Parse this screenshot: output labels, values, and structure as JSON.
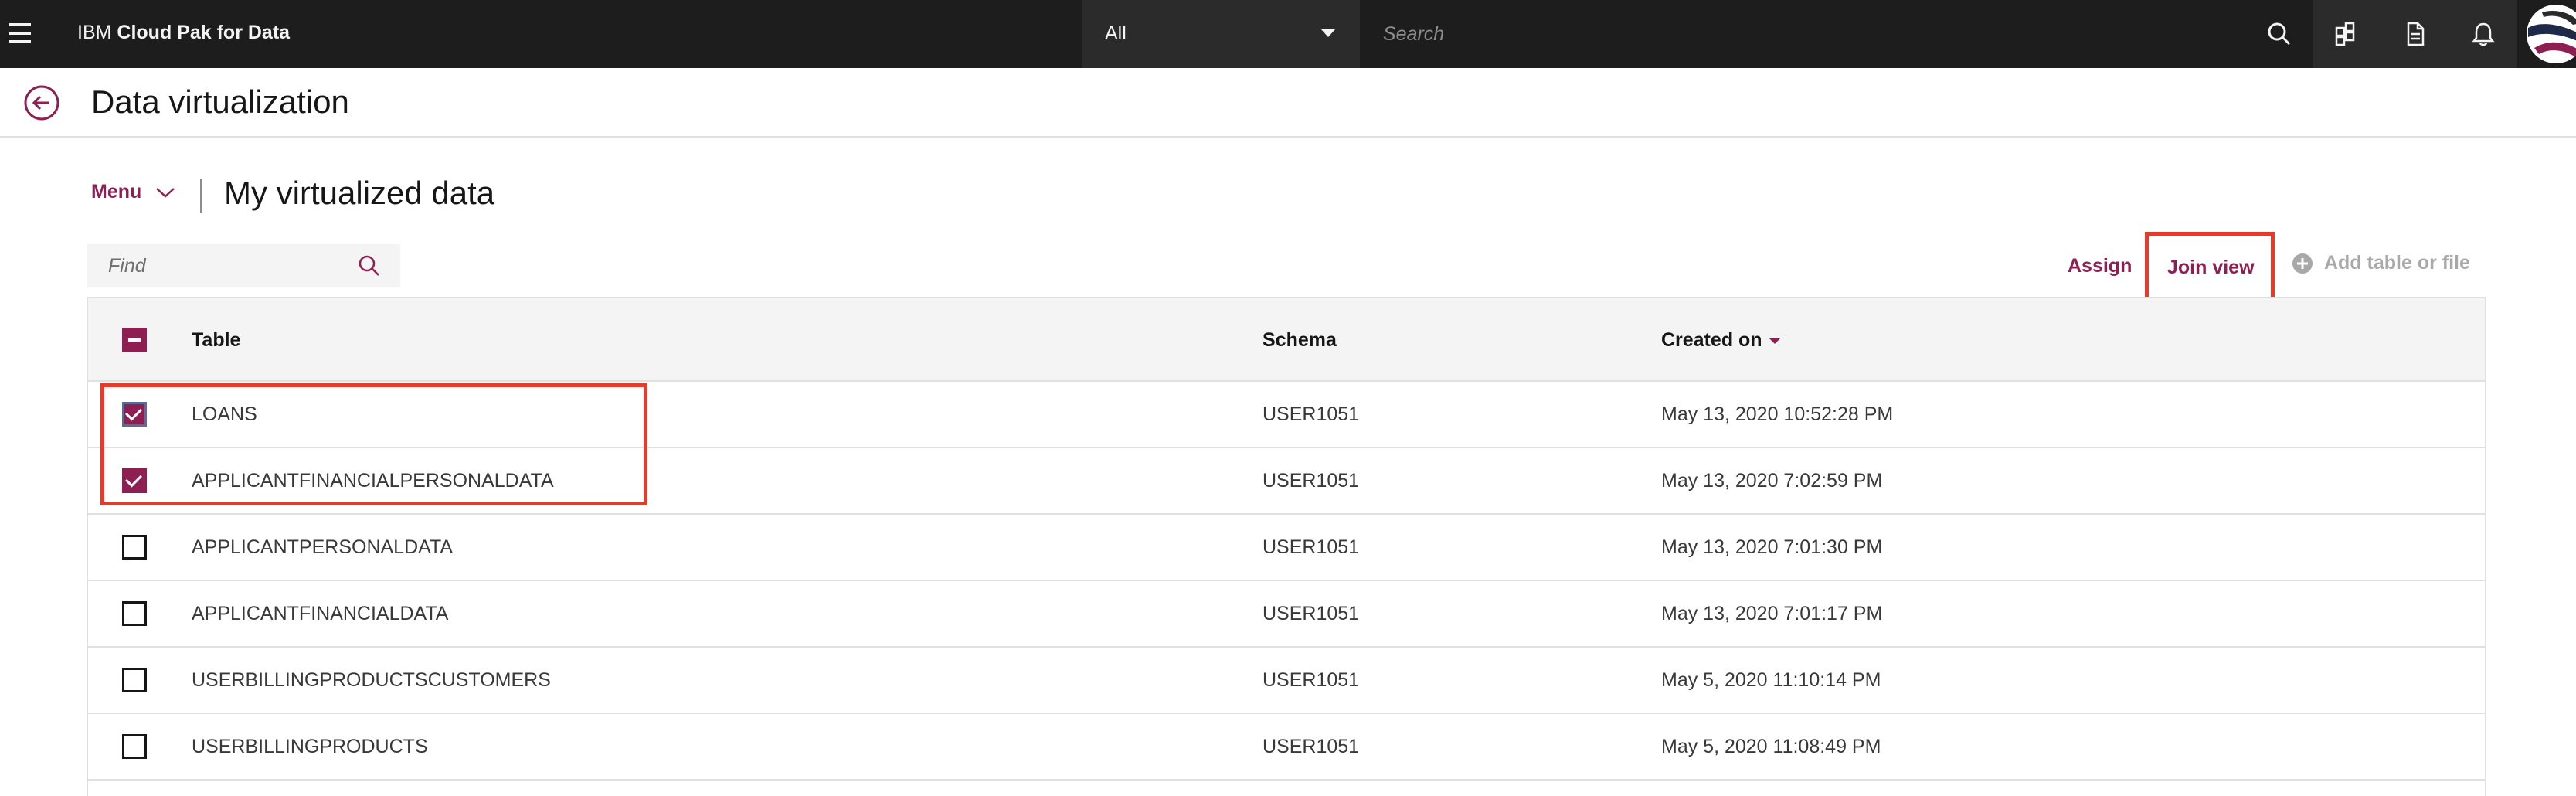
{
  "topbar": {
    "brand_prefix": "IBM ",
    "brand_name": "Cloud Pak for Data",
    "scope_selected": "All",
    "search_placeholder": "Search"
  },
  "page": {
    "title": "Data virtualization"
  },
  "content": {
    "menu_label": "Menu",
    "section_title": "My virtualized data",
    "find_placeholder": "Find",
    "actions": {
      "assign": "Assign",
      "join_view": "Join view",
      "add_table": "Add table or file"
    }
  },
  "table": {
    "columns": {
      "table": "Table",
      "schema": "Schema",
      "created_on": "Created on"
    },
    "sort": {
      "column": "created_on",
      "direction": "descending"
    },
    "select_all_state": "indeterminate",
    "rows": [
      {
        "name": "LOANS",
        "schema": "USER1051",
        "created": "May 13, 2020 10:52:28 PM",
        "checked": true
      },
      {
        "name": "APPLICANTFINANCIALPERSONALDATA",
        "schema": "USER1051",
        "created": "May 13, 2020 7:02:59 PM",
        "checked": true
      },
      {
        "name": "APPLICANTPERSONALDATA",
        "schema": "USER1051",
        "created": "May 13, 2020 7:01:30 PM",
        "checked": false
      },
      {
        "name": "APPLICANTFINANCIALDATA",
        "schema": "USER1051",
        "created": "May 13, 2020 7:01:17 PM",
        "checked": false
      },
      {
        "name": "USERBILLINGPRODUCTSCUSTOMERS",
        "schema": "USER1051",
        "created": "May 5, 2020 11:10:14 PM",
        "checked": false
      },
      {
        "name": "USERBILLINGPRODUCTS",
        "schema": "USER1051",
        "created": "May 5, 2020 11:08:49 PM",
        "checked": false
      }
    ]
  },
  "colors": {
    "accent": "#8e1f52",
    "topbar": "#1d1d1d",
    "annotation_box": "#e63b2a"
  }
}
